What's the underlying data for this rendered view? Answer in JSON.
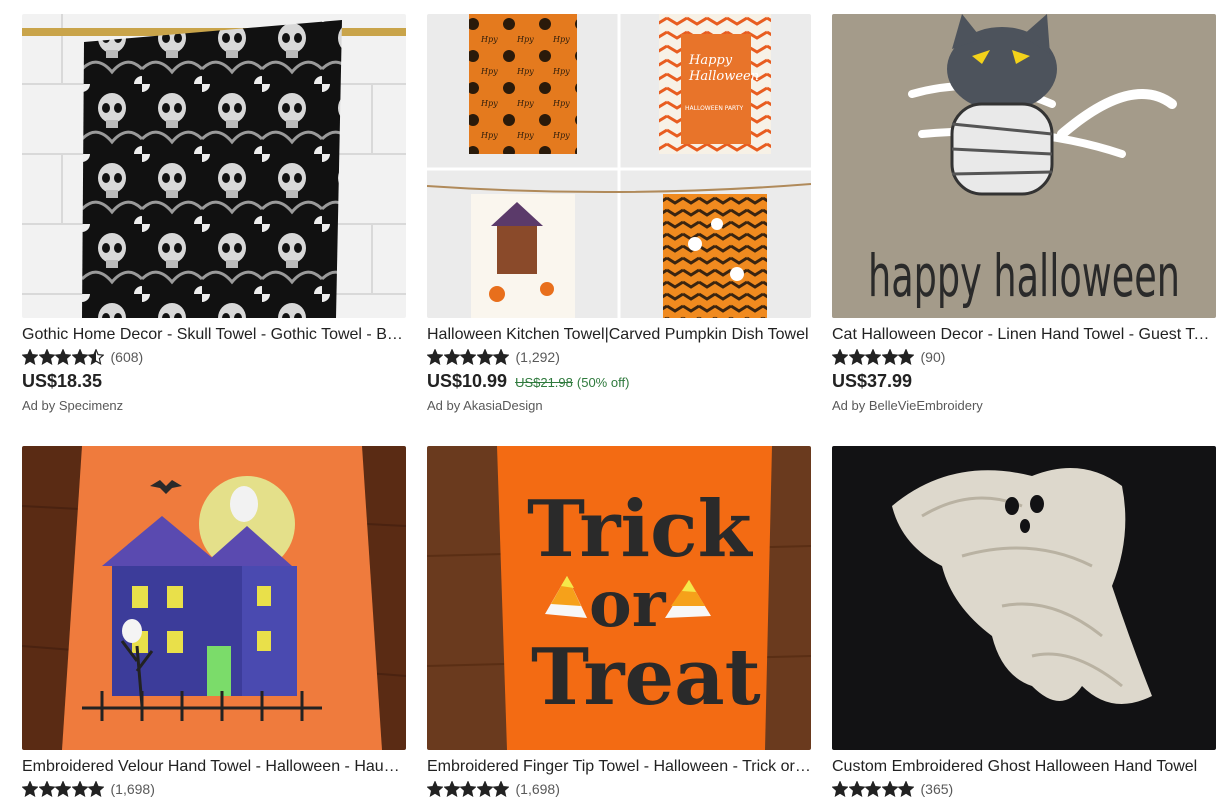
{
  "listings": [
    {
      "title": "Gothic Home Decor - Skull Towel - Gothic Towel - Bathroom Decor",
      "stars": 4.5,
      "review_count": "(608)",
      "price": "US$18.35",
      "ad_by": "Ad by Specimenz"
    },
    {
      "title": "Halloween Kitchen Towel|Carved Pumpkin Dish Towel",
      "stars": 5,
      "review_count": "(1,292)",
      "price": "US$10.99",
      "original_price": "US$21.98",
      "discount": "(50% off)",
      "ad_by": "Ad by AkasiaDesign",
      "image_text": {
        "happy": "Happy",
        "halloween": "Halloween",
        "party": "HALLOWEEN PARTY"
      }
    },
    {
      "title": "Cat Halloween Decor - Linen Hand Towel - Guest Towel",
      "stars": 5,
      "review_count": "(90)",
      "price": "US$37.99",
      "ad_by": "Ad by BelleVieEmbroidery",
      "image_text": {
        "caption": "happy halloween"
      }
    },
    {
      "title": "Embroidered Velour Hand Towel - Halloween - Haunted House",
      "stars": 5,
      "review_count": "(1,698)"
    },
    {
      "title": "Embroidered Finger Tip Towel - Halloween - Trick or Treat",
      "stars": 5,
      "review_count": "(1,698)",
      "image_text": {
        "line1": "Trick",
        "line2": "or",
        "line3": "Treat"
      }
    },
    {
      "title": "Custom Embroidered Ghost Halloween Hand Towel",
      "stars": 5,
      "review_count": "(365)"
    }
  ],
  "colors": {
    "star": "#222222",
    "discount_green": "#2f7a3d",
    "orange": "#f07a22"
  }
}
